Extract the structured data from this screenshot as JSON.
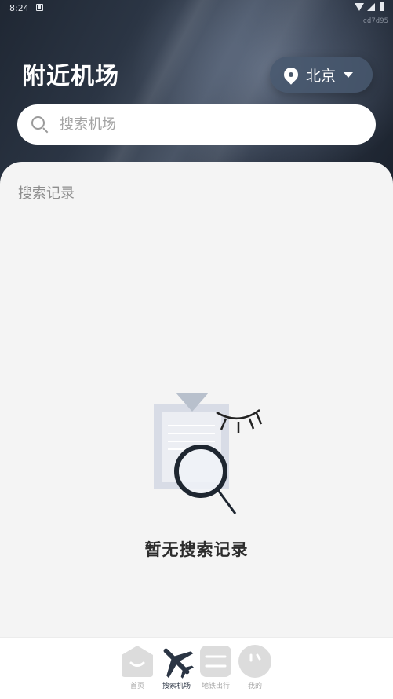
{
  "status_bar": {
    "time": "8:24",
    "watermark": "cd7d95"
  },
  "header": {
    "title": "附近机场",
    "city": "北京"
  },
  "search": {
    "placeholder": "搜索机场",
    "value": ""
  },
  "history": {
    "section_title": "搜索记录",
    "empty_text": "暂无搜索记录"
  },
  "bottom_nav": {
    "items": [
      {
        "label": "首页",
        "icon": "home-icon",
        "active": false
      },
      {
        "label": "搜索机场",
        "icon": "airplane-icon",
        "active": true
      },
      {
        "label": "地铁出行",
        "icon": "subway-icon",
        "active": false
      },
      {
        "label": "我的",
        "icon": "profile-icon",
        "active": false
      }
    ]
  },
  "colors": {
    "header_dark": "#1f2733",
    "active_nav": "#2b3544",
    "inactive_nav": "#d9d9d9",
    "panel_bg": "#f4f4f4"
  }
}
